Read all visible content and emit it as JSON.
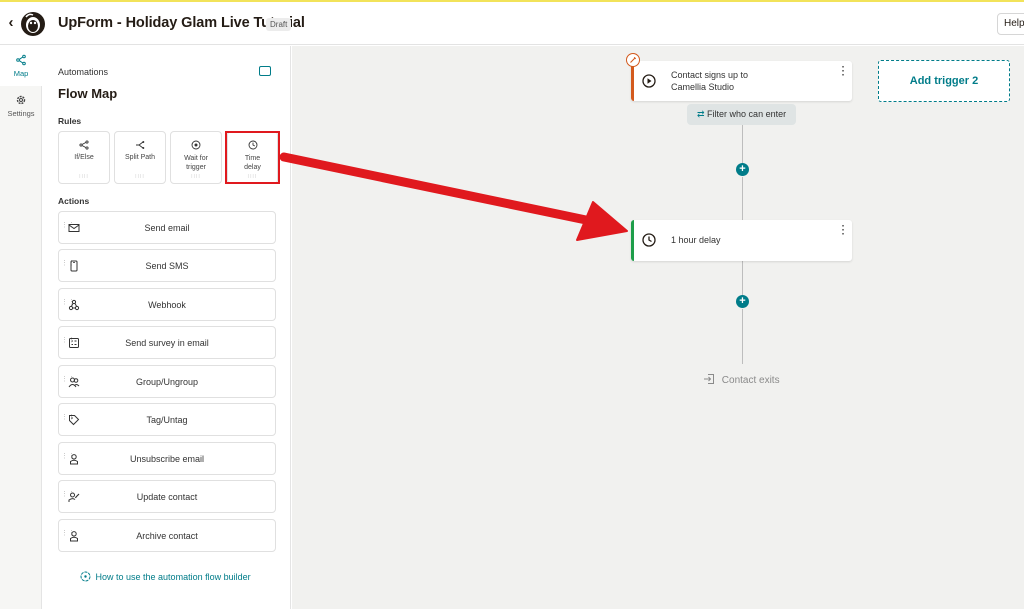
{
  "header": {
    "back_label": "‹",
    "title": "UpForm - Holiday Glam Live Tutorial",
    "badge": "Draft",
    "help_label": "Help"
  },
  "rail": {
    "items": [
      {
        "label": "Map",
        "icon": "branch-icon",
        "active": true
      },
      {
        "label": "Settings",
        "icon": "gear-icon",
        "active": false
      }
    ]
  },
  "panel": {
    "breadcrumb": "Automations",
    "title": "Flow Map",
    "rules_label": "Rules",
    "rules": [
      {
        "label": "If/Else",
        "icon": "branch-icon"
      },
      {
        "label": "Split Path",
        "icon": "split-icon"
      },
      {
        "label": "Wait for trigger",
        "icon": "wait-icon"
      },
      {
        "label": "Time delay",
        "icon": "clock-icon",
        "highlighted": true
      }
    ],
    "actions_label": "Actions",
    "actions": [
      {
        "label": "Send email",
        "icon": "envelope-icon"
      },
      {
        "label": "Send SMS",
        "icon": "phone-icon"
      },
      {
        "label": "Webhook",
        "icon": "webhook-icon"
      },
      {
        "label": "Send survey in email",
        "icon": "survey-icon"
      },
      {
        "label": "Group/Ungroup",
        "icon": "group-icon"
      },
      {
        "label": "Tag/Untag",
        "icon": "tag-icon"
      },
      {
        "label": "Unsubscribe email",
        "icon": "person-icon"
      },
      {
        "label": "Update contact",
        "icon": "edit-person-icon"
      },
      {
        "label": "Archive contact",
        "icon": "person-icon"
      }
    ],
    "help_link": "How to use the automation flow builder"
  },
  "canvas": {
    "trigger_line1": "Contact signs up to",
    "trigger_line2": "Camellia Studio",
    "filter_label": "Filter who can enter",
    "delay_label": "1 hour delay",
    "exit_label": "Contact exits",
    "add_trigger_label": "Add trigger 2"
  },
  "colors": {
    "accent": "#007c89",
    "trigger_bar": "#d35a1d",
    "delay_bar": "#1e9e4a",
    "annotation_red": "#e0191e"
  }
}
